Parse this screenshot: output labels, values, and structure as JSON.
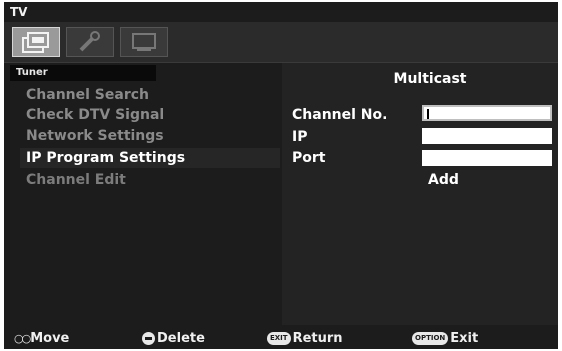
{
  "window": {
    "title": "TV"
  },
  "tabs": [
    {
      "icon": "picture-icon"
    },
    {
      "icon": "setup-icon"
    },
    {
      "icon": "screen-icon"
    }
  ],
  "left_panel": {
    "section_label": "Tuner",
    "items": [
      {
        "label": "Channel Search"
      },
      {
        "label": "Check DTV Signal"
      },
      {
        "label": "Network Settings"
      },
      {
        "label": "IP Program Settings",
        "selected": true
      },
      {
        "label": "Channel Edit"
      }
    ]
  },
  "right_panel": {
    "title": "Multicast",
    "fields": [
      {
        "label": "Channel No.",
        "value": ""
      },
      {
        "label": "IP",
        "value": ""
      },
      {
        "label": "Port",
        "value": ""
      }
    ],
    "add_label": "Add"
  },
  "footer": {
    "move_key": "○○",
    "move_label": "Move",
    "delete_label": "Delete",
    "return_key": "EXIT",
    "return_label": "Return",
    "exit_key": "OPTION",
    "exit_label": "Exit"
  }
}
